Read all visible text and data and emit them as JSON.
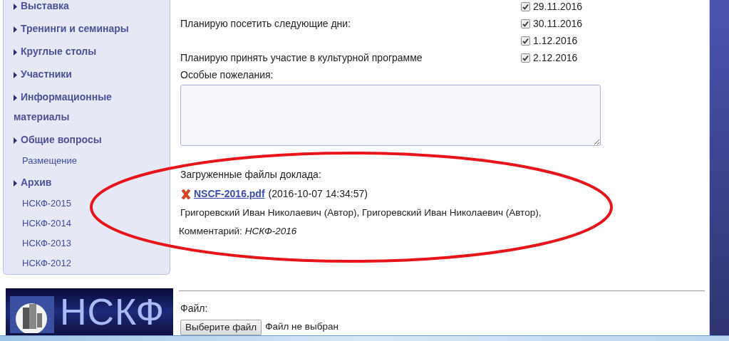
{
  "sidebar": {
    "items": [
      {
        "label": "Выставка"
      },
      {
        "label": "Тренинги и семинары"
      },
      {
        "label": "Круглые столы"
      },
      {
        "label": "Участники"
      },
      {
        "label": "Информационные материалы"
      },
      {
        "label": "Общие вопросы",
        "children": [
          {
            "label": "Размещение"
          }
        ]
      },
      {
        "label": "Архив",
        "children": [
          {
            "label": "НСКФ-2015"
          },
          {
            "label": "НСКФ-2014"
          },
          {
            "label": "НСКФ-2013"
          },
          {
            "label": "НСКФ-2012"
          }
        ]
      }
    ]
  },
  "logo": {
    "text": "НСКФ"
  },
  "form": {
    "attendance_rows": [
      {
        "date": "29.11.2016",
        "checked": true
      },
      {
        "label": "Планирую посетить следующие дни:",
        "date": "30.11.2016",
        "checked": true
      },
      {
        "date": "1.12.2016",
        "checked": true
      },
      {
        "label": "Планирую принять участие в культурной программе",
        "date": "2.12.2016",
        "checked": true
      }
    ],
    "wishes": {
      "label": "Особые пожелания:"
    },
    "uploaded": {
      "title": "Загруженные файлы доклада:",
      "files": [
        {
          "name": "NSCF-2016.pdf",
          "timestamp": "(2016-10-07 14:34:57)",
          "authors": "Григоревский Иван Николаевич (Автор), Григоревский Иван Николаевич (Автор),",
          "comment_label": "Комментарий:",
          "comment": "НСКФ-2016"
        }
      ]
    },
    "file_input": {
      "label": "Файл:",
      "button": "Выберите файл",
      "status": "Файл не выбран"
    }
  }
}
